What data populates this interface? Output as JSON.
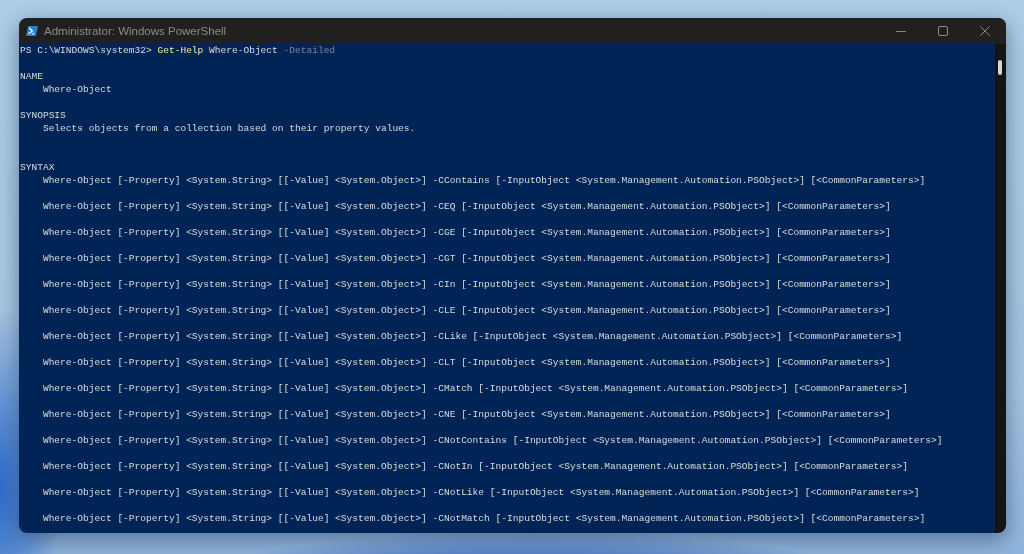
{
  "window": {
    "title": "Administrator: Windows PowerShell"
  },
  "console": {
    "command_line": [
      {
        "text": "PS C:\\WINDOWS\\system32>",
        "kind": "prompt"
      },
      {
        "text": "Get-Help",
        "kind": "command"
      },
      {
        "text": "Where-Object",
        "kind": "argument"
      },
      {
        "text": "-Detailed",
        "kind": "parameter"
      }
    ],
    "sections": [
      {
        "kind": "text",
        "heading": "NAME",
        "lines": [
          "Where-Object"
        ]
      },
      {
        "kind": "text",
        "heading": "SYNOPSIS",
        "lines": [
          "Selects objects from a collection based on their property values."
        ]
      },
      {
        "kind": "syntax",
        "heading": "SYNTAX",
        "lines": [
          "Where-Object [-Property] <System.String> [[-Value] <System.Object>] -CContains [-InputObject <System.Management.Automation.PSObject>] [<CommonParameters>]",
          "Where-Object [-Property] <System.String> [[-Value] <System.Object>] -CEQ [-InputObject <System.Management.Automation.PSObject>] [<CommonParameters>]",
          "Where-Object [-Property] <System.String> [[-Value] <System.Object>] -CGE [-InputObject <System.Management.Automation.PSObject>] [<CommonParameters>]",
          "Where-Object [-Property] <System.String> [[-Value] <System.Object>] -CGT [-InputObject <System.Management.Automation.PSObject>] [<CommonParameters>]",
          "Where-Object [-Property] <System.String> [[-Value] <System.Object>] -CIn [-InputObject <System.Management.Automation.PSObject>] [<CommonParameters>]",
          "Where-Object [-Property] <System.String> [[-Value] <System.Object>] -CLE [-InputObject <System.Management.Automation.PSObject>] [<CommonParameters>]",
          "Where-Object [-Property] <System.String> [[-Value] <System.Object>] -CLike [-InputObject <System.Management.Automation.PSObject>] [<CommonParameters>]",
          "Where-Object [-Property] <System.String> [[-Value] <System.Object>] -CLT [-InputObject <System.Management.Automation.PSObject>] [<CommonParameters>]",
          "Where-Object [-Property] <System.String> [[-Value] <System.Object>] -CMatch [-InputObject <System.Management.Automation.PSObject>] [<CommonParameters>]",
          "Where-Object [-Property] <System.String> [[-Value] <System.Object>] -CNE [-InputObject <System.Management.Automation.PSObject>] [<CommonParameters>]",
          "Where-Object [-Property] <System.String> [[-Value] <System.Object>] -CNotContains [-InputObject <System.Management.Automation.PSObject>] [<CommonParameters>]",
          "Where-Object [-Property] <System.String> [[-Value] <System.Object>] -CNotIn [-InputObject <System.Management.Automation.PSObject>] [<CommonParameters>]",
          "Where-Object [-Property] <System.String> [[-Value] <System.Object>] -CNotLike [-InputObject <System.Management.Automation.PSObject>] [<CommonParameters>]",
          "Where-Object [-Property] <System.String> [[-Value] <System.Object>] -CNotMatch [-InputObject <System.Management.Automation.PSObject>] [<CommonParameters>]"
        ]
      }
    ]
  }
}
